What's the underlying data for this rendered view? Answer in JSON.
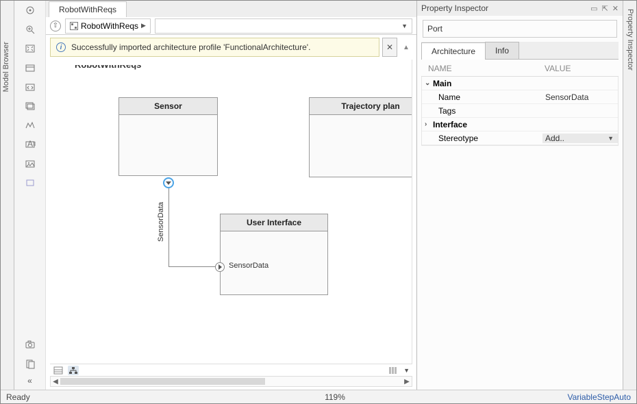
{
  "tabstrip": {
    "tab1": "RobotWithReqs"
  },
  "breadcrumb": {
    "model": "RobotWithReqs"
  },
  "notification": {
    "message": "Successfully imported architecture profile 'FunctionalArchitecture'."
  },
  "canvas": {
    "title": "RobotWithReqs",
    "blocks": {
      "sensor": "Sensor",
      "trajectory": "Trajectory plan",
      "ui": "User Interface"
    },
    "ports": {
      "sensor_out_label": "SensorData",
      "ui_in_label": "SensorData"
    }
  },
  "sidestrips": {
    "model_browser": "Model Browser",
    "property_inspector": "Property Inspector"
  },
  "inspector": {
    "title": "Property Inspector",
    "type": "Port",
    "tabs": {
      "arch": "Architecture",
      "info": "Info"
    },
    "headers": {
      "name": "NAME",
      "value": "VALUE"
    },
    "sections": {
      "main": "Main",
      "interface": "Interface"
    },
    "rows": {
      "name_label": "Name",
      "name_value": "SensorData",
      "tags_label": "Tags",
      "tags_value": "",
      "stereo_label": "Stereotype",
      "stereo_value": "Add.."
    }
  },
  "status": {
    "ready": "Ready",
    "zoom": "119%",
    "solver": "VariableStepAuto"
  }
}
